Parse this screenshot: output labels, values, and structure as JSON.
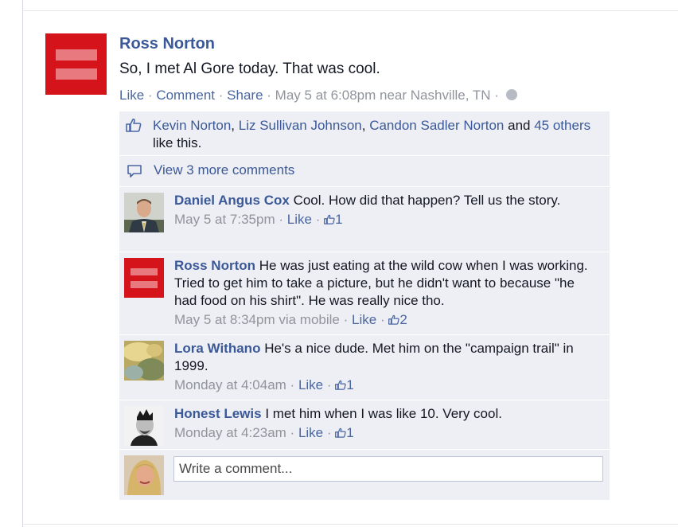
{
  "post": {
    "author": "Ross Norton",
    "message": "So, I met Al Gore today. That was cool.",
    "actions": {
      "like": "Like",
      "comment": "Comment",
      "share": "Share",
      "sep": "·"
    },
    "timestamp": "May 5 at 6:08pm near Nashville, TN",
    "privacy_icon": "globe-icon"
  },
  "likes": {
    "names": [
      "Kevin Norton",
      "Liz Sullivan Johnson",
      "Candon Sadler Norton"
    ],
    "comma": ",",
    "and": "and",
    "others_link": "45 others",
    "suffix": "like this."
  },
  "view_more": "View 3 more comments",
  "comments": [
    {
      "name": "Daniel Angus Cox",
      "text": "Cool. How did that happen? Tell us the story.",
      "time": "May 5 at 7:35pm",
      "like": "Like",
      "count": "1"
    },
    {
      "name": "Ross Norton",
      "text": "He was just eating at the wild cow when I was working. Tried to get him to take a picture, but he didn't want to because \"he had food on his shirt\". He was really nice tho.",
      "time": "May 5 at 8:34pm via mobile",
      "like": "Like",
      "count": "2"
    },
    {
      "name": "Lora Withano",
      "text": "He's a nice dude. Met him on the \"campaign trail\" in 1999.",
      "time": "Monday at 4:04am",
      "like": "Like",
      "count": "1"
    },
    {
      "name": "Honest Lewis",
      "text": "I met him when I was like 10. Very cool.",
      "time": "Monday at 4:23am",
      "like": "Like",
      "count": "1"
    }
  ],
  "composer": {
    "placeholder": "Write a comment..."
  },
  "colors": {
    "link": "#3b5998",
    "ufi_background": "#edeff4",
    "hrc_red": "#d4131b",
    "hrc_bar": "#e8797e"
  }
}
